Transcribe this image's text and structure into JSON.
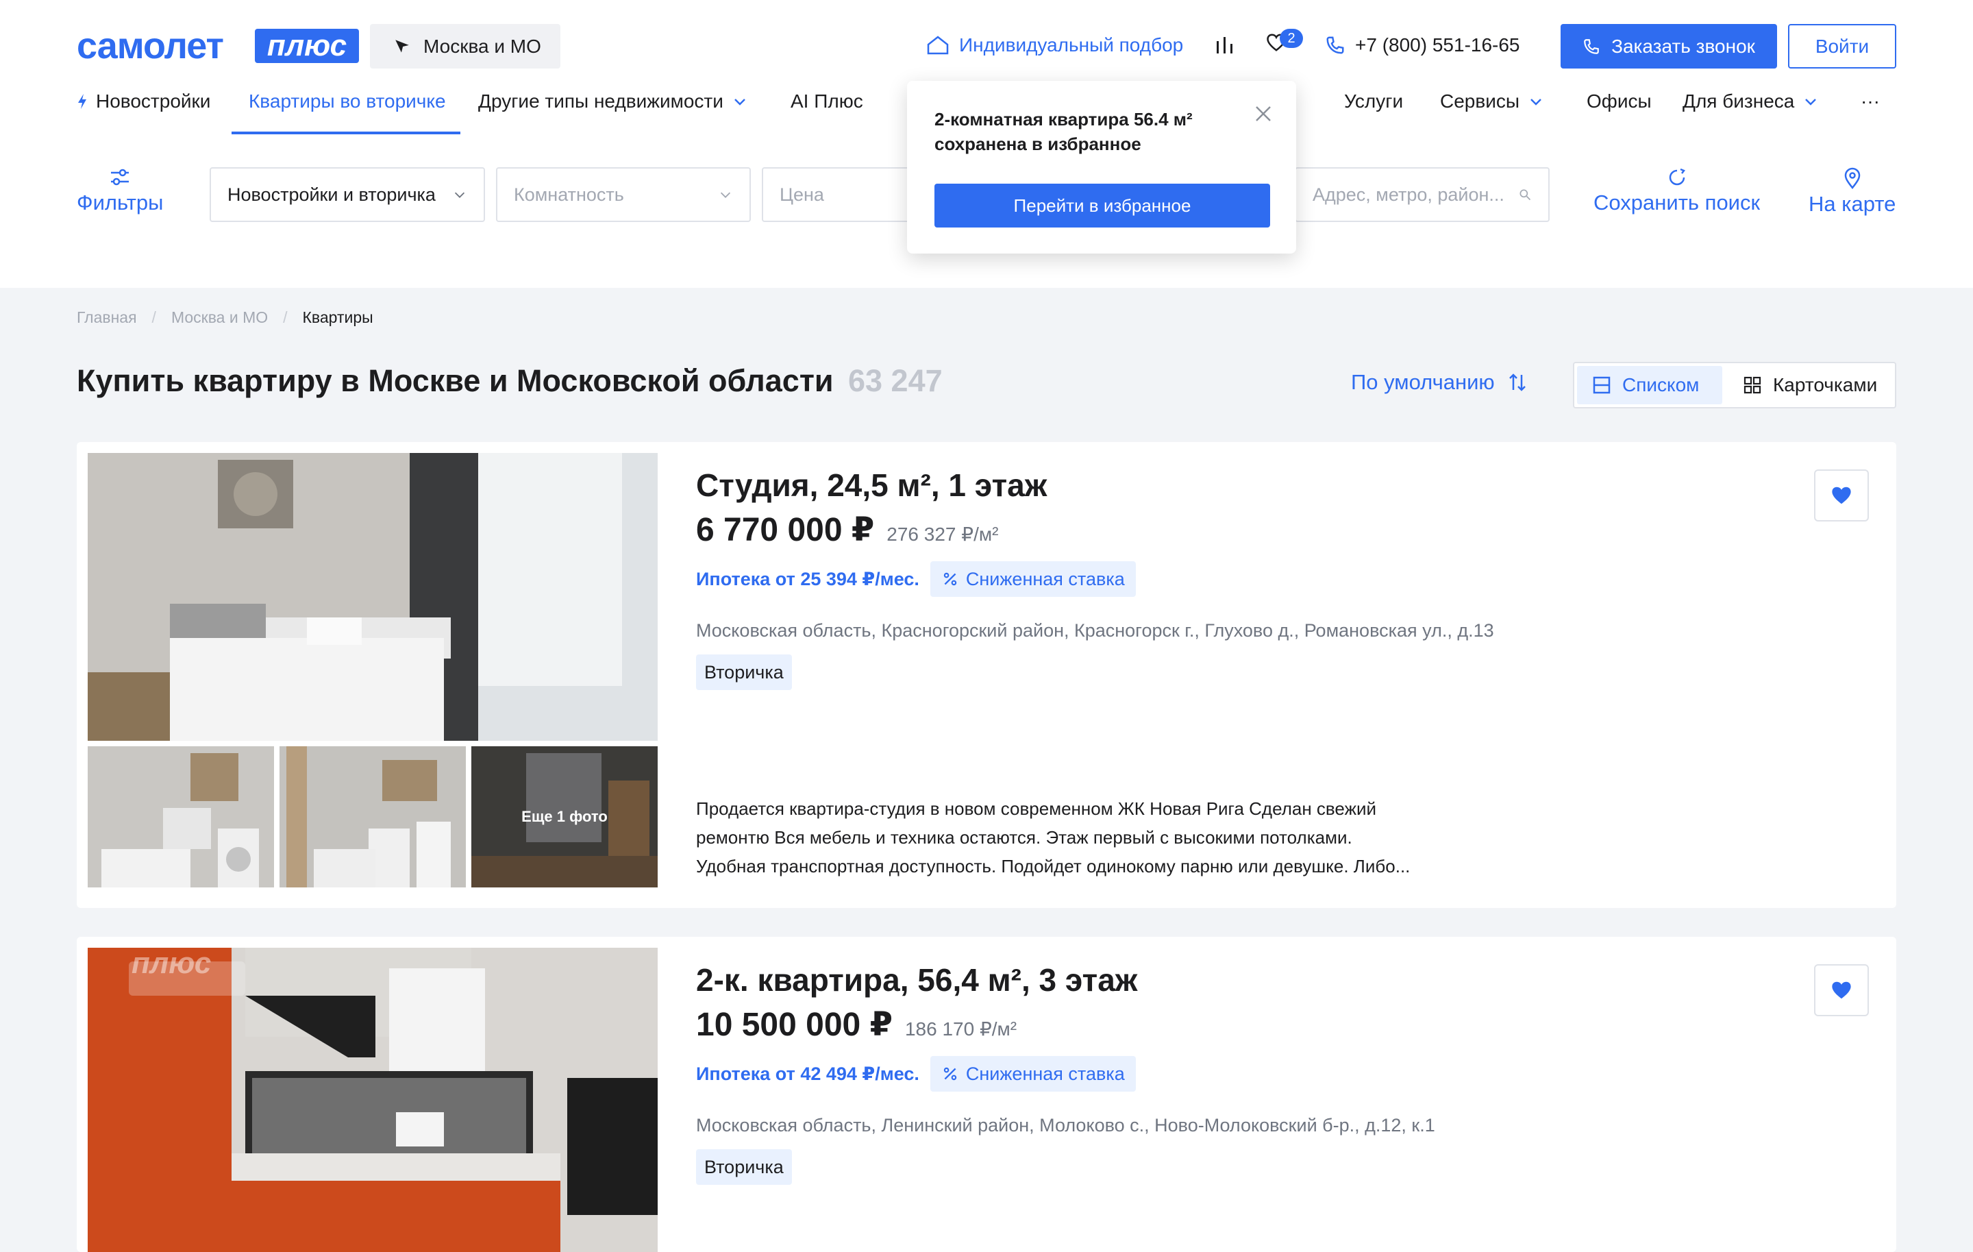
{
  "header": {
    "logo_main": "самолет",
    "logo_plus": "плюс",
    "city": "Москва и МО",
    "individual": "Индивидуальный подбор",
    "fav_count": "2",
    "phone": "+7 (800) 551-16-65",
    "call_button": "Заказать звонок",
    "login_button": "Войти"
  },
  "nav": {
    "new_buildings": "Новостройки",
    "secondary": "Квартиры во вторичке",
    "other_types": "Другие типы недвижимости",
    "ai_plus": "AI Плюс",
    "services": "Услуги",
    "tools": "Сервисы",
    "offices": "Офисы",
    "business": "Для бизнеса",
    "more": "···"
  },
  "filters": {
    "filters_label": "Фильтры",
    "type_value": "Новостройки и вторичка",
    "rooms_placeholder": "Комнатность",
    "price_placeholder": "Цена",
    "address_placeholder": "Адрес, метро, район...",
    "save_search": "Сохранить поиск",
    "on_map": "На карте"
  },
  "popup": {
    "message": "2-комнатная квартира 56.4 м² сохранена в избранное",
    "button": "Перейти в избранное"
  },
  "breadcrumbs": [
    "Главная",
    "Москва и МО",
    "Квартиры"
  ],
  "page": {
    "title": "Купить квартиру в Москве и Московской области",
    "count": "63 247",
    "sort": "По умолчанию",
    "view_list": "Списком",
    "view_cards": "Карточками"
  },
  "listings": [
    {
      "title": "Студия, 24,5 м², 1 этаж",
      "price": "6 770 000 ₽",
      "price_sqm": "276 327 ₽/м²",
      "mortgage": "Ипотека от 25 394 ₽/мес.",
      "rate_badge": "Сниженная ставка",
      "address": "Московская область, Красногорский район, Красногорск г., Глухово д., Романовская ул., д.13",
      "tag": "Вторичка",
      "more_photos": "Еще 1 фото",
      "description_lines": [
        "Продается квартира-студия в новом современном ЖК Новая Рига Сделан свежий",
        "ремонтю Вся мебель и техника остаются. Этаж первый с высокими потолками.",
        "Удобная транспортная доступность. Подойдет одинокому парню или девушке. Либо..."
      ]
    },
    {
      "title": "2-к. квартира, 56,4 м², 3 этаж",
      "price": "10 500 000 ₽",
      "price_sqm": "186 170 ₽/м²",
      "mortgage": "Ипотека от 42 494 ₽/мес.",
      "rate_badge": "Сниженная ставка",
      "address": "Московская область, Ленинский район, Молоково с., Ново-Молоковский б-р., д.12, к.1",
      "tag": "Вторичка",
      "photo_watermark": "плюс"
    }
  ],
  "colors": {
    "accent": "#2f6cf0",
    "background": "#f2f4f7",
    "badge_bg": "#e9f1fe"
  }
}
